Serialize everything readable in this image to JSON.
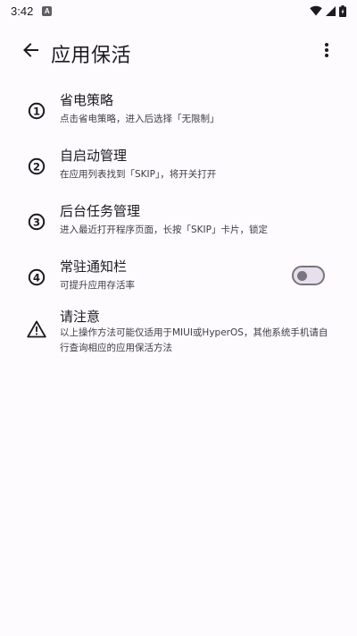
{
  "status_bar": {
    "time": "3:42",
    "notification_badge": "A",
    "icons": [
      "wifi-icon",
      "signal-icon",
      "battery-icon"
    ]
  },
  "app_bar": {
    "title": "应用保活",
    "back_icon": "arrow-back-icon",
    "menu_icon": "more-vert-icon"
  },
  "steps": [
    {
      "number": "1",
      "title": "省电策略",
      "description": "点击省电策略，进入后选择「无限制」"
    },
    {
      "number": "2",
      "title": "自启动管理",
      "description": "在应用列表找到「SKIP」，将开关打开"
    },
    {
      "number": "3",
      "title": "后台任务管理",
      "description": "进入最近打开程序页面，长按「SKIP」卡片，锁定"
    },
    {
      "number": "4",
      "title": "常驻通知栏",
      "description": "可提升应用存活率",
      "toggle_on": false
    }
  ],
  "notice": {
    "icon": "warning-icon",
    "title": "请注意",
    "description": "以上操作方法可能仅适用于MIUI或HyperOS，其他系统手机请自行查询相应的应用保活方法"
  },
  "colors": {
    "background": "#fefbff",
    "text_primary": "#1c1b1f",
    "text_secondary": "#3d3c42",
    "switch_outline": "#79747e",
    "switch_track": "#e7e0ec"
  }
}
